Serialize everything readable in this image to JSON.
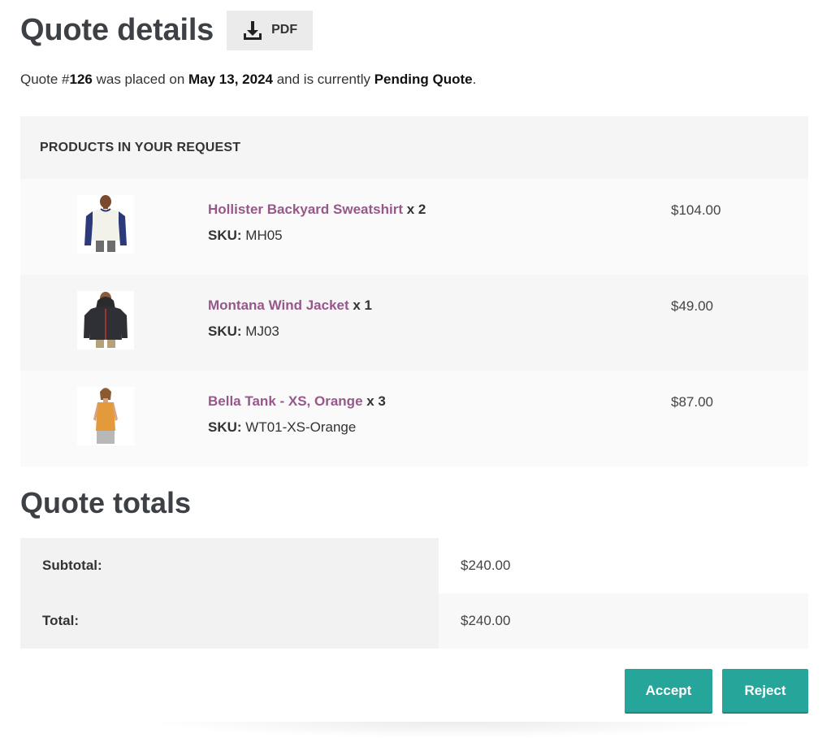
{
  "header": {
    "title": "Quote details",
    "pdf_label": "PDF",
    "download_icon": "download-icon"
  },
  "status": {
    "prefix": "Quote #",
    "quote_number": "126",
    "placed_text": " was placed on ",
    "date": "May 13, 2024",
    "currently_text": " and is currently ",
    "state": "Pending Quote",
    "suffix": "."
  },
  "products": {
    "heading": "PRODUCTS IN YOUR REQUEST",
    "sku_label": "SKU:",
    "items": [
      {
        "name": "Hollister Backyard Sweatshirt",
        "qty": " x 2",
        "sku": " MH05",
        "price": "$104.00",
        "image": "sweatshirt-image"
      },
      {
        "name": "Montana Wind Jacket",
        "qty": " x 1",
        "sku": " MJ03",
        "price": "$49.00",
        "image": "jacket-image"
      },
      {
        "name": "Bella Tank - XS, Orange",
        "qty": " x 3",
        "sku": " WT01-XS-Orange",
        "price": "$87.00",
        "image": "tank-image"
      }
    ]
  },
  "totals": {
    "title": "Quote totals",
    "rows": [
      {
        "label": "Subtotal:",
        "value": "$240.00"
      },
      {
        "label": "Total:",
        "value": "$240.00"
      }
    ]
  },
  "actions": {
    "accept_label": "Accept",
    "reject_label": "Reject"
  },
  "colors": {
    "accent": "#26a69a",
    "link": "#96588a"
  }
}
